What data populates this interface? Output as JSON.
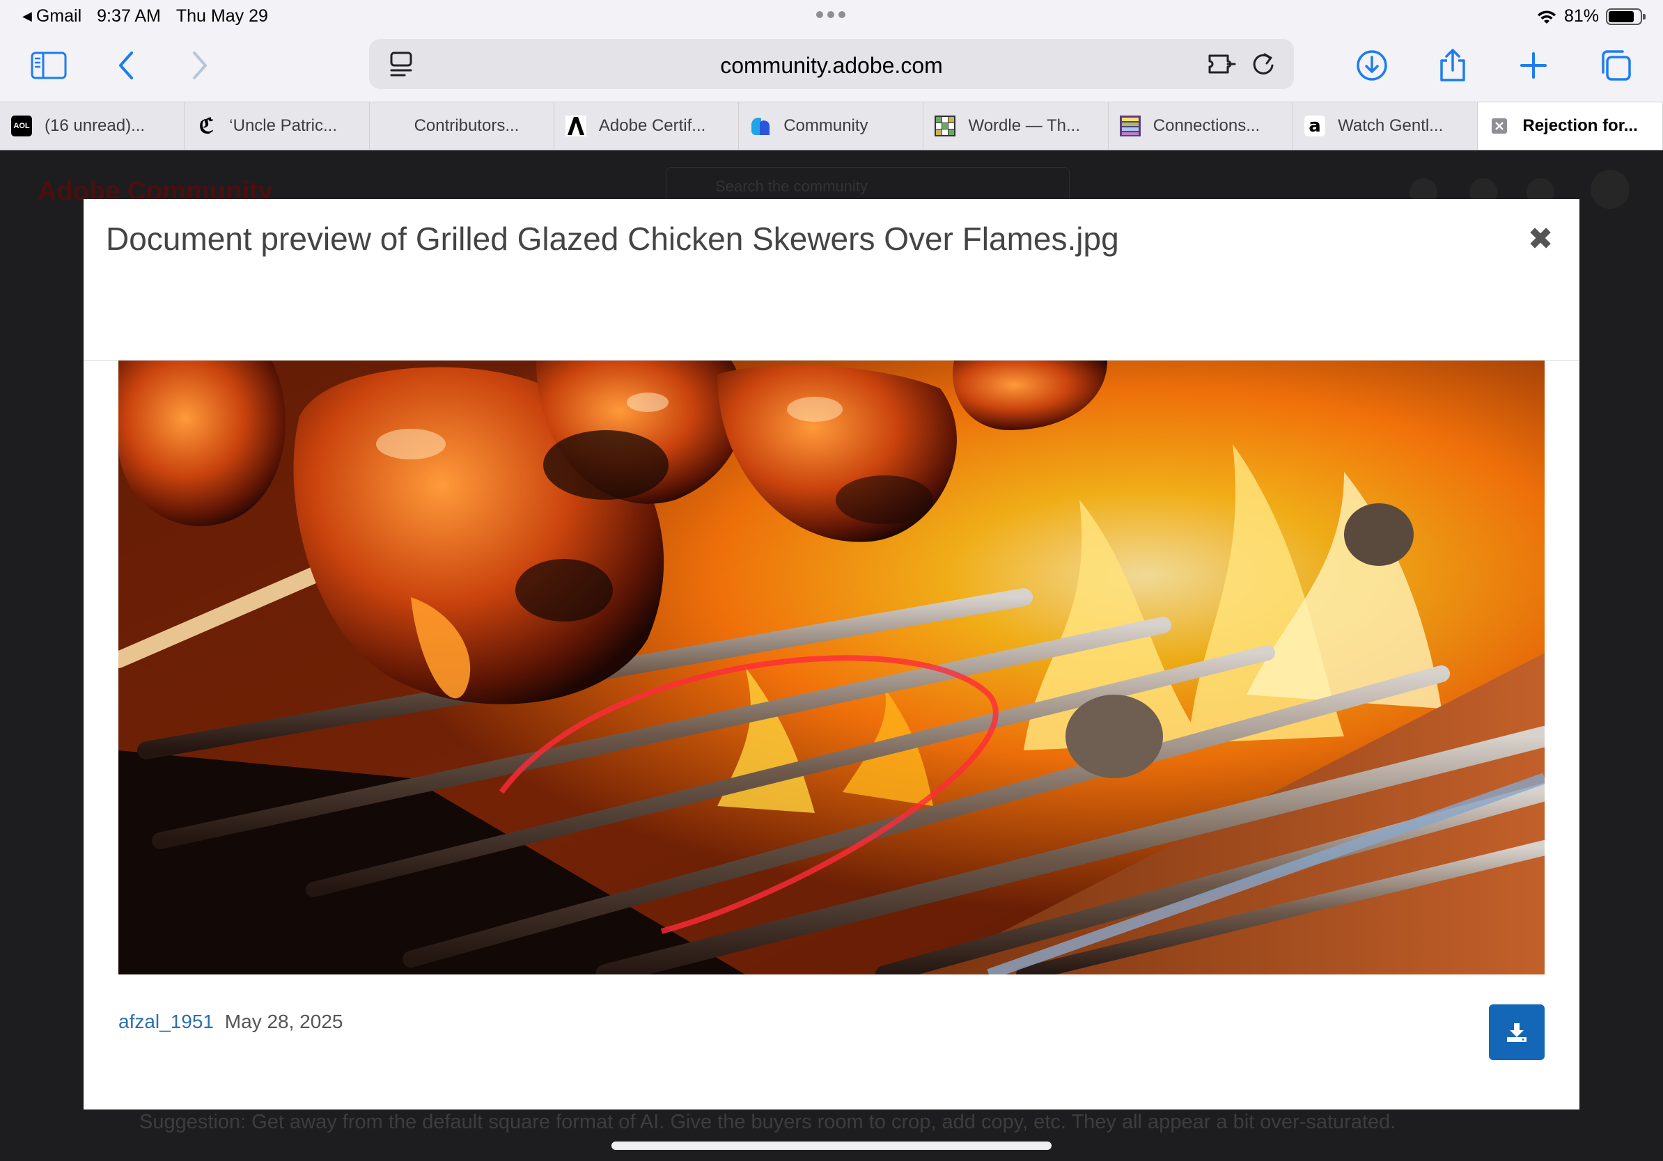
{
  "status_bar": {
    "back_app": "Gmail",
    "time": "9:37 AM",
    "date": "Thu May 29",
    "battery_percent": "81%",
    "battery_level": 0.81
  },
  "toolbar": {
    "url": "community.adobe.com"
  },
  "tabs": [
    {
      "label": "(16 unread)...",
      "favicon": "aol-icon",
      "active": false
    },
    {
      "label": "‘Uncle Patric...",
      "favicon": "nyt-icon",
      "active": false
    },
    {
      "label": "Contributors...",
      "favicon": "",
      "active": false
    },
    {
      "label": "Adobe Certif...",
      "favicon": "adobe-icon",
      "active": false
    },
    {
      "label": "Community",
      "favicon": "community-icon",
      "active": false
    },
    {
      "label": "Wordle — Th...",
      "favicon": "wordle-icon",
      "active": false
    },
    {
      "label": "Connections...",
      "favicon": "connections-icon",
      "active": false
    },
    {
      "label": "Watch Gentl...",
      "favicon": "amazon-icon",
      "active": false
    },
    {
      "label": "Rejection for...",
      "favicon": "close-tab-icon",
      "active": true
    }
  ],
  "background_page": {
    "logo": "Adobe Community",
    "search_placeholder": "Search the community",
    "suggestion": "Suggestion: Get away from the default square format of AI. Give the buyers room to crop, add copy, etc. They all appear a bit over-saturated."
  },
  "modal": {
    "title": "Document preview of Grilled Glazed Chicken Skewers Over Flames.jpg",
    "close_symbol": "✖",
    "author": "afzal_1951",
    "date": "May 28, 2025"
  },
  "colors": {
    "accent_blue": "#1467b6",
    "link_blue": "#2a6fb0",
    "safari_blue": "#1e7cf0"
  }
}
